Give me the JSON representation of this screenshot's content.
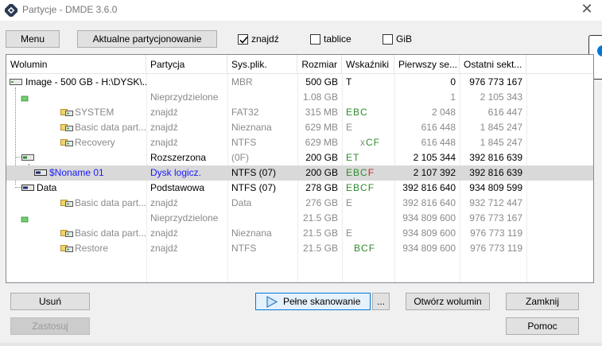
{
  "window": {
    "title": "Partycje - DMDE 3.6.0",
    "close_glyph": "✕"
  },
  "toolbar": {
    "menu_label": "Menu",
    "current_partitioning_label": "Aktualne partycjonowanie",
    "found_label": "znajdź",
    "found_checked": true,
    "tables_label": "tablice",
    "tables_checked": false,
    "gib_label": "GiB",
    "gib_checked": false
  },
  "columns": [
    "Wolumin",
    "Partycja",
    "Sys.plik.",
    "Rozmiar",
    "Wskaźniki",
    "Pierwszy se...",
    "Ostatni sekt..."
  ],
  "rows": [
    {
      "volume": "Image - 500 GB - H:\\DYSK\\...",
      "partition": "",
      "fs": "MBR",
      "size": "500 GB",
      "flags": [
        {
          "t": "T",
          "c": "#000000"
        }
      ],
      "first": "0",
      "last": "976 773 167",
      "style": "normal",
      "fs_gray": true
    },
    {
      "volume": "",
      "partition": "Nieprzydzielone",
      "fs": "",
      "size": "1.08 GB",
      "flags": [],
      "first": "1",
      "last": "2 105 343",
      "style": "gray"
    },
    {
      "volume": "SYSTEM",
      "partition": "znajdź",
      "fs": "FAT32",
      "size": "315 MB",
      "flags": [
        {
          "t": "E",
          "c": "#2e8b2e"
        },
        {
          "t": "B",
          "c": "#2e8b2e"
        },
        {
          "t": "C",
          "c": "#2e8b2e"
        }
      ],
      "first": "2 048",
      "last": "616 447",
      "style": "gray"
    },
    {
      "volume": "Basic data part...",
      "partition": "znajdź",
      "fs": "Nieznana",
      "size": "629 MB",
      "flags": [
        {
          "t": "E",
          "c": "#8a8a8a"
        }
      ],
      "first": "616 448",
      "last": "1 845 247",
      "style": "gray"
    },
    {
      "volume": "Recovery",
      "partition": "znajdź",
      "fs": "NTFS",
      "size": "629 MB",
      "flags": [
        {
          "t": "x",
          "c": "#8a8a8a"
        },
        {
          "t": "C",
          "c": "#2e8b2e"
        },
        {
          "t": "F",
          "c": "#2e8b2e"
        }
      ],
      "first": "616 448",
      "last": "1 845 247",
      "style": "gray"
    },
    {
      "volume": "",
      "partition": "Rozszerzona",
      "fs": "(0F)",
      "size": "200 GB",
      "flags": [
        {
          "t": "E",
          "c": "#2e8b2e"
        },
        {
          "t": "T",
          "c": "#2e8b2e"
        }
      ],
      "first": "2 105 344",
      "last": "392 816 639",
      "style": "normal",
      "fs_gray": true
    },
    {
      "volume": "$Noname 01",
      "partition": "Dysk logicz.",
      "fs": "NTFS (07)",
      "size": "200 GB",
      "flags": [
        {
          "t": "E",
          "c": "#2e8b2e"
        },
        {
          "t": "B",
          "c": "#2e8b2e"
        },
        {
          "t": "C",
          "c": "#2e8b2e"
        },
        {
          "t": "F",
          "c": "#d02020"
        }
      ],
      "first": "2 107 392",
      "last": "392 816 639",
      "style": "selected"
    },
    {
      "volume": "Data",
      "partition": "Podstawowa",
      "fs": "NTFS (07)",
      "size": "278 GB",
      "flags": [
        {
          "t": "E",
          "c": "#2e8b2e"
        },
        {
          "t": "B",
          "c": "#2e8b2e"
        },
        {
          "t": "C",
          "c": "#2e8b2e"
        },
        {
          "t": "F",
          "c": "#2e8b2e"
        }
      ],
      "first": "392 816 640",
      "last": "934 809 599",
      "style": "normal"
    },
    {
      "volume": "Basic data part...",
      "partition": "znajdź",
      "fs": "Data",
      "size": "276 GB",
      "flags": [
        {
          "t": "E",
          "c": "#8a8a8a"
        }
      ],
      "first": "392 816 640",
      "last": "932 712 447",
      "style": "gray"
    },
    {
      "volume": "",
      "partition": "Nieprzydzielone",
      "fs": "",
      "size": "21.5 GB",
      "flags": [],
      "first": "934 809 600",
      "last": "976 773 167",
      "style": "gray"
    },
    {
      "volume": "Basic data part...",
      "partition": "znajdź",
      "fs": "Nieznana",
      "size": "21.5 GB",
      "flags": [
        {
          "t": "E",
          "c": "#8a8a8a"
        }
      ],
      "first": "934 809 600",
      "last": "976 773 119",
      "style": "gray"
    },
    {
      "volume": "Restore",
      "partition": "znajdź",
      "fs": "NTFS",
      "size": "21.5 GB",
      "flags": [
        {
          "t": "B",
          "c": "#2e8b2e"
        },
        {
          "t": "C",
          "c": "#2e8b2e"
        },
        {
          "t": "F",
          "c": "#2e8b2e"
        }
      ],
      "first": "934 809 600",
      "last": "976 773 119",
      "style": "gray"
    }
  ],
  "buttons": {
    "delete_label": "Usuń",
    "apply_label": "Zastosuj",
    "full_scan_label": "Pełne skanowanie",
    "more_label": "...",
    "open_volume_label": "Otwórz wolumin",
    "close_label": "Zamknij",
    "help_label": "Pomoc"
  },
  "colors": {
    "accent": "#0078d7",
    "selected_row": "#d9d9d9",
    "green_flag": "#2e8b2e",
    "red_flag": "#d02020",
    "blue_text": "#1a1aff"
  }
}
